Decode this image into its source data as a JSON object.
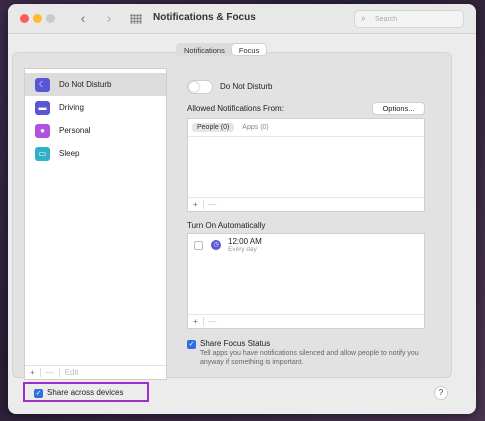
{
  "window": {
    "title": "Notifications & Focus"
  },
  "search": {
    "placeholder": "Search"
  },
  "tabs": [
    "Notifications",
    "Focus"
  ],
  "sidebar": {
    "items": [
      {
        "label": "Do Not Disturb",
        "icon": "moon-icon",
        "color": "#5856d6"
      },
      {
        "label": "Driving",
        "icon": "car-icon",
        "color": "#5856d6"
      },
      {
        "label": "Personal",
        "icon": "person-icon",
        "color": "#af52de"
      },
      {
        "label": "Sleep",
        "icon": "bed-icon",
        "color": "#30b0c7"
      }
    ],
    "footer": {
      "add": "+",
      "remove": "—",
      "edit": "Edit"
    }
  },
  "detail": {
    "toggle_label": "Do Not Disturb",
    "allowed_label": "Allowed Notifications From:",
    "options_label": "Options...",
    "allowed_tabs": [
      "People (0)",
      "Apps (0)"
    ],
    "allowed_footer": {
      "add": "+",
      "remove": "—"
    },
    "turn_on_label": "Turn On Automatically",
    "schedule": {
      "time": "12:00 AM",
      "repeat": "Every day"
    },
    "schedule_footer": {
      "add": "+",
      "remove": "—"
    },
    "share_focus": {
      "label": "Share Focus Status",
      "description": "Tell apps you have notifications silenced and allow people to notify you anyway if something is important."
    }
  },
  "share_devices": {
    "label": "Share across devices"
  },
  "help": {
    "label": "?"
  }
}
